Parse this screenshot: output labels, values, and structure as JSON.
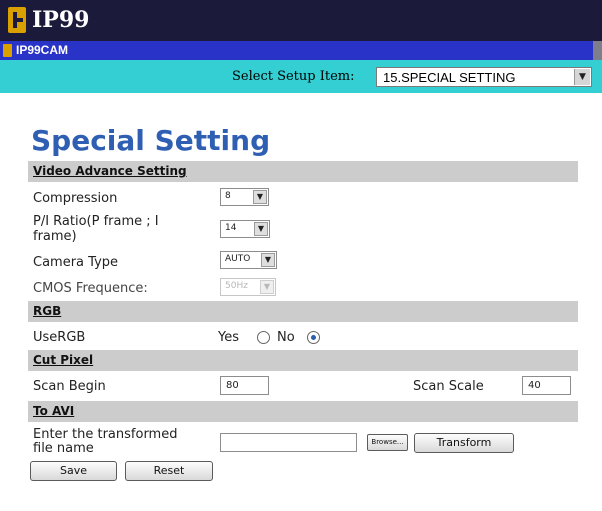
{
  "brand": {
    "logo_text": "IP99",
    "camera_name": "IP99CAM"
  },
  "setup": {
    "label": "Select Setup Item:",
    "selected": "15.SPECIAL SETTING"
  },
  "page": {
    "title": "Special Setting"
  },
  "video_advance": {
    "section_title": "Video Advance Setting",
    "compression": {
      "label": "Compression",
      "value": "8"
    },
    "pi_ratio": {
      "label_line1": "P/I Ratio(P frame ; I",
      "label_line2": "frame)",
      "value": "14"
    },
    "camera_type": {
      "label": "Camera Type",
      "value": "AUTO"
    },
    "cmos_frequence": {
      "label": "CMOS Frequence:",
      "value": "50Hz",
      "disabled": true
    }
  },
  "rgb": {
    "section_title": "RGB",
    "use_rgb_label": "UseRGB",
    "yes_label": "Yes",
    "no_label": "No",
    "selected": "No"
  },
  "cut_pixel": {
    "section_title": "Cut Pixel",
    "scan_begin_label": "Scan Begin",
    "scan_begin_value": "80",
    "scan_scale_label": "Scan Scale",
    "scan_scale_value": "40"
  },
  "to_avi": {
    "section_title": "To AVI",
    "filename_label_line1": "Enter the transformed",
    "filename_label_line2": "file name",
    "filename_value": "",
    "browse_label": "Browse...",
    "transform_label": "Transform"
  },
  "actions": {
    "save_label": "Save",
    "reset_label": "Reset"
  },
  "colors": {
    "header_bg": "#1c1a3a",
    "camera_bar": "#2933c8",
    "setup_bar": "#33cfd3",
    "title_blue": "#2f5fb3",
    "section_bg": "#cccccc"
  }
}
